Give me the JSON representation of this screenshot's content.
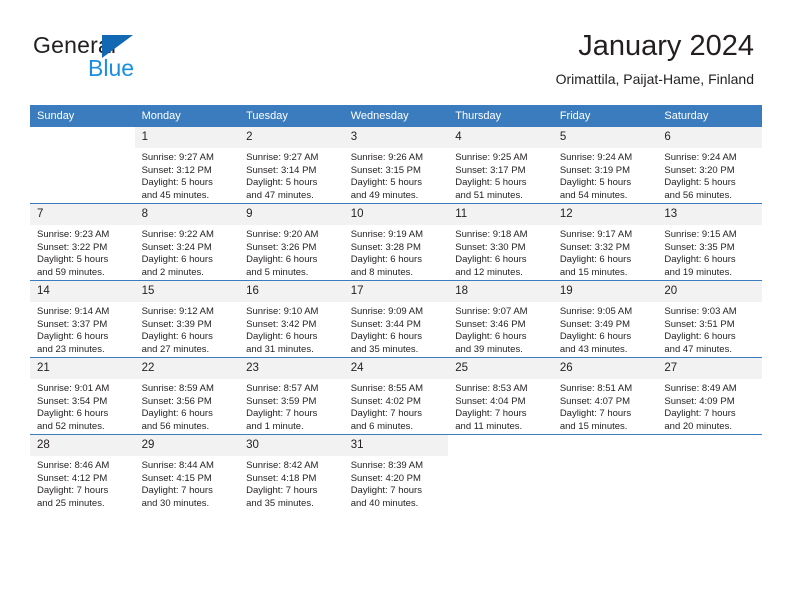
{
  "brand": {
    "word1": "General",
    "word2": "Blue",
    "triangle_color": "#1268b3",
    "blue_text_color": "#1a8fe0"
  },
  "header": {
    "title": "January 2024",
    "subtitle": "Orimattila, Paijat-Hame, Finland"
  },
  "calendar": {
    "header_bg": "#3b7cbf",
    "daynum_bg": "#f2f2f2",
    "weekday_headers": [
      "Sunday",
      "Monday",
      "Tuesday",
      "Wednesday",
      "Thursday",
      "Friday",
      "Saturday"
    ],
    "weeks": [
      [
        {
          "day": "",
          "lines": []
        },
        {
          "day": "1",
          "lines": [
            "Sunrise: 9:27 AM",
            "Sunset: 3:12 PM",
            "Daylight: 5 hours",
            "and 45 minutes."
          ]
        },
        {
          "day": "2",
          "lines": [
            "Sunrise: 9:27 AM",
            "Sunset: 3:14 PM",
            "Daylight: 5 hours",
            "and 47 minutes."
          ]
        },
        {
          "day": "3",
          "lines": [
            "Sunrise: 9:26 AM",
            "Sunset: 3:15 PM",
            "Daylight: 5 hours",
            "and 49 minutes."
          ]
        },
        {
          "day": "4",
          "lines": [
            "Sunrise: 9:25 AM",
            "Sunset: 3:17 PM",
            "Daylight: 5 hours",
            "and 51 minutes."
          ]
        },
        {
          "day": "5",
          "lines": [
            "Sunrise: 9:24 AM",
            "Sunset: 3:19 PM",
            "Daylight: 5 hours",
            "and 54 minutes."
          ]
        },
        {
          "day": "6",
          "lines": [
            "Sunrise: 9:24 AM",
            "Sunset: 3:20 PM",
            "Daylight: 5 hours",
            "and 56 minutes."
          ]
        }
      ],
      [
        {
          "day": "7",
          "lines": [
            "Sunrise: 9:23 AM",
            "Sunset: 3:22 PM",
            "Daylight: 5 hours",
            "and 59 minutes."
          ]
        },
        {
          "day": "8",
          "lines": [
            "Sunrise: 9:22 AM",
            "Sunset: 3:24 PM",
            "Daylight: 6 hours",
            "and 2 minutes."
          ]
        },
        {
          "day": "9",
          "lines": [
            "Sunrise: 9:20 AM",
            "Sunset: 3:26 PM",
            "Daylight: 6 hours",
            "and 5 minutes."
          ]
        },
        {
          "day": "10",
          "lines": [
            "Sunrise: 9:19 AM",
            "Sunset: 3:28 PM",
            "Daylight: 6 hours",
            "and 8 minutes."
          ]
        },
        {
          "day": "11",
          "lines": [
            "Sunrise: 9:18 AM",
            "Sunset: 3:30 PM",
            "Daylight: 6 hours",
            "and 12 minutes."
          ]
        },
        {
          "day": "12",
          "lines": [
            "Sunrise: 9:17 AM",
            "Sunset: 3:32 PM",
            "Daylight: 6 hours",
            "and 15 minutes."
          ]
        },
        {
          "day": "13",
          "lines": [
            "Sunrise: 9:15 AM",
            "Sunset: 3:35 PM",
            "Daylight: 6 hours",
            "and 19 minutes."
          ]
        }
      ],
      [
        {
          "day": "14",
          "lines": [
            "Sunrise: 9:14 AM",
            "Sunset: 3:37 PM",
            "Daylight: 6 hours",
            "and 23 minutes."
          ]
        },
        {
          "day": "15",
          "lines": [
            "Sunrise: 9:12 AM",
            "Sunset: 3:39 PM",
            "Daylight: 6 hours",
            "and 27 minutes."
          ]
        },
        {
          "day": "16",
          "lines": [
            "Sunrise: 9:10 AM",
            "Sunset: 3:42 PM",
            "Daylight: 6 hours",
            "and 31 minutes."
          ]
        },
        {
          "day": "17",
          "lines": [
            "Sunrise: 9:09 AM",
            "Sunset: 3:44 PM",
            "Daylight: 6 hours",
            "and 35 minutes."
          ]
        },
        {
          "day": "18",
          "lines": [
            "Sunrise: 9:07 AM",
            "Sunset: 3:46 PM",
            "Daylight: 6 hours",
            "and 39 minutes."
          ]
        },
        {
          "day": "19",
          "lines": [
            "Sunrise: 9:05 AM",
            "Sunset: 3:49 PM",
            "Daylight: 6 hours",
            "and 43 minutes."
          ]
        },
        {
          "day": "20",
          "lines": [
            "Sunrise: 9:03 AM",
            "Sunset: 3:51 PM",
            "Daylight: 6 hours",
            "and 47 minutes."
          ]
        }
      ],
      [
        {
          "day": "21",
          "lines": [
            "Sunrise: 9:01 AM",
            "Sunset: 3:54 PM",
            "Daylight: 6 hours",
            "and 52 minutes."
          ]
        },
        {
          "day": "22",
          "lines": [
            "Sunrise: 8:59 AM",
            "Sunset: 3:56 PM",
            "Daylight: 6 hours",
            "and 56 minutes."
          ]
        },
        {
          "day": "23",
          "lines": [
            "Sunrise: 8:57 AM",
            "Sunset: 3:59 PM",
            "Daylight: 7 hours",
            "and 1 minute."
          ]
        },
        {
          "day": "24",
          "lines": [
            "Sunrise: 8:55 AM",
            "Sunset: 4:02 PM",
            "Daylight: 7 hours",
            "and 6 minutes."
          ]
        },
        {
          "day": "25",
          "lines": [
            "Sunrise: 8:53 AM",
            "Sunset: 4:04 PM",
            "Daylight: 7 hours",
            "and 11 minutes."
          ]
        },
        {
          "day": "26",
          "lines": [
            "Sunrise: 8:51 AM",
            "Sunset: 4:07 PM",
            "Daylight: 7 hours",
            "and 15 minutes."
          ]
        },
        {
          "day": "27",
          "lines": [
            "Sunrise: 8:49 AM",
            "Sunset: 4:09 PM",
            "Daylight: 7 hours",
            "and 20 minutes."
          ]
        }
      ],
      [
        {
          "day": "28",
          "lines": [
            "Sunrise: 8:46 AM",
            "Sunset: 4:12 PM",
            "Daylight: 7 hours",
            "and 25 minutes."
          ]
        },
        {
          "day": "29",
          "lines": [
            "Sunrise: 8:44 AM",
            "Sunset: 4:15 PM",
            "Daylight: 7 hours",
            "and 30 minutes."
          ]
        },
        {
          "day": "30",
          "lines": [
            "Sunrise: 8:42 AM",
            "Sunset: 4:18 PM",
            "Daylight: 7 hours",
            "and 35 minutes."
          ]
        },
        {
          "day": "31",
          "lines": [
            "Sunrise: 8:39 AM",
            "Sunset: 4:20 PM",
            "Daylight: 7 hours",
            "and 40 minutes."
          ]
        },
        {
          "day": "",
          "lines": []
        },
        {
          "day": "",
          "lines": []
        },
        {
          "day": "",
          "lines": []
        }
      ]
    ]
  }
}
